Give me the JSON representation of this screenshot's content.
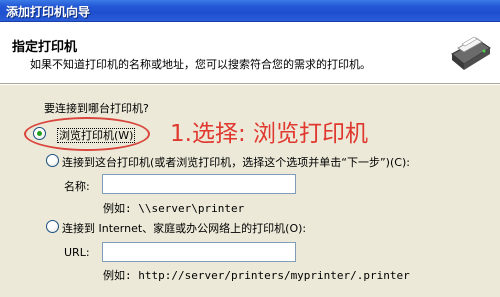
{
  "window": {
    "title": "添加打印机向导"
  },
  "header": {
    "title": "指定打印机",
    "subtitle": "如果不知道打印机的名称或地址，您可以搜索符合您的需求的打印机。"
  },
  "form": {
    "question": "要连接到哪台打印机?",
    "options": [
      {
        "label": "浏览打印机(W)",
        "selected": true
      },
      {
        "label": "连接到这台打印机(或者浏览打印机，选择这个选项并单击“下一步”)(C):",
        "selected": false
      },
      {
        "label": "连接到 Internet、家庭或办公网络上的打印机(O):",
        "selected": false
      }
    ],
    "name_label": "名称:",
    "name_value": "",
    "name_example": "例如: \\\\server\\printer",
    "url_label": "URL:",
    "url_value": "",
    "url_example": "例如: http://server/printers/myprinter/.printer"
  },
  "annotation": {
    "text": "1.选择: 浏览打印机",
    "color": "#e0382f"
  },
  "icons": {
    "header": "printer-icon"
  },
  "colors": {
    "titlebar": "#2458d6",
    "selected_radio": "#21a121",
    "annotation": "#e0382f"
  }
}
